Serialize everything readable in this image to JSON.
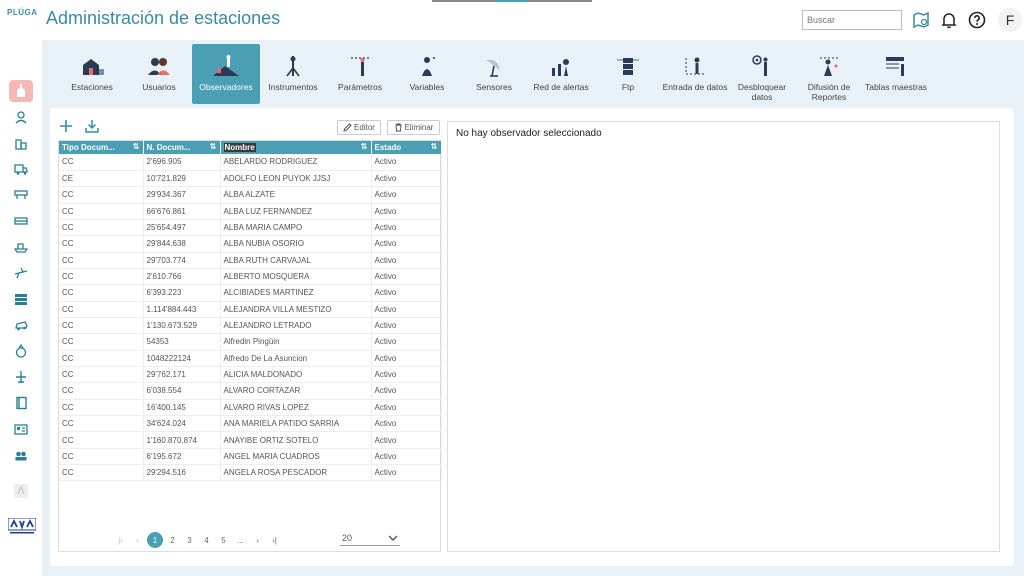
{
  "app": {
    "logo": "PLÜGA",
    "title": "Administración de estaciones"
  },
  "header": {
    "search_placeholder": "Buscar",
    "user_initial": "F"
  },
  "nav": {
    "items": [
      {
        "label": "Estaciones"
      },
      {
        "label": "Usuarios"
      },
      {
        "label": "Observadores",
        "active": true
      },
      {
        "label": "Instrumentos"
      },
      {
        "label": "Parámetros"
      },
      {
        "label": "Variables"
      },
      {
        "label": "Sensores"
      },
      {
        "label": "Red de alertas"
      },
      {
        "label": "Ftp"
      },
      {
        "label": "Entrada de datos"
      },
      {
        "label": "Desbloquear datos"
      },
      {
        "label": "Difusión de Reportes"
      },
      {
        "label": "Tablas maestras"
      }
    ]
  },
  "toolbar": {
    "edit_label": "Editor",
    "delete_label": "Eliminar"
  },
  "table": {
    "columns": [
      "Tipo Docum...",
      "N. Docum...",
      "Nombre",
      "Estado"
    ],
    "rows": [
      [
        "CC",
        "2'696.905",
        "ABELARDO RODRIGUEZ",
        "Activo"
      ],
      [
        "CE",
        "10'721.829",
        "ADOLFO LEON PUYOK JJSJ",
        "Activo"
      ],
      [
        "CC",
        "29'934.367",
        "ALBA ALZATE",
        "Activo"
      ],
      [
        "CC",
        "66'676.861",
        "ALBA LUZ FERNANDEZ",
        "Activo"
      ],
      [
        "CC",
        "25'654.497",
        "ALBA MARIA CAMPO",
        "Activo"
      ],
      [
        "CC",
        "29'844.638",
        "ALBA NUBIA OSORIO",
        "Activo"
      ],
      [
        "CC",
        "29'703.774",
        "ALBA RUTH CARVAJAL",
        "Activo"
      ],
      [
        "CC",
        "2'610.766",
        "ALBERTO MOSQUERA",
        "Activo"
      ],
      [
        "CC",
        "6'393.223",
        "ALCIBIADES MARTINEZ",
        "Activo"
      ],
      [
        "CC",
        "1.114'884.443",
        "ALEJANDRA VILLA MESTIZO",
        "Activo"
      ],
      [
        "CC",
        "1'130.673.529",
        "ALEJANDRO LETRADO",
        "Activo"
      ],
      [
        "CC",
        "54353",
        "Alfredin Pingüin",
        "Activo"
      ],
      [
        "CC",
        "1048222124",
        "Alfredo De La Asuncion",
        "Activo"
      ],
      [
        "CC",
        "29'762.171",
        "ALICIA MALDONADO",
        "Activo"
      ],
      [
        "CC",
        "6'038.554",
        "ALVARO CORTAZAR",
        "Activo"
      ],
      [
        "CC",
        "16'400.145",
        "ALVARO RIVAS LOPEZ",
        "Activo"
      ],
      [
        "CC",
        "34'624.024",
        "ANA MARIELA PATIDO SARRIA",
        "Activo"
      ],
      [
        "CC",
        "1'160.870.874",
        "ANAYIBE ORTIZ SOTELO",
        "Activo"
      ],
      [
        "CC",
        "6'195.672",
        "ANGEL MARIA CUADROS",
        "Activo"
      ],
      [
        "CC",
        "29'294.516",
        "ANGELA ROSA PESCADOR",
        "Activo"
      ]
    ]
  },
  "pager": {
    "first": "|‹",
    "prev": "‹",
    "pages": [
      "1",
      "2",
      "3",
      "4",
      "5",
      "..."
    ],
    "next": "›",
    "last": "›|",
    "page_size": "20"
  },
  "detail": {
    "empty_message": "No hay observador seleccionado"
  },
  "colors": {
    "accent": "#4a9fb5",
    "title": "#3b8aa0",
    "content_bg": "#e8f1f8",
    "sidebar_active": "#f5b8b8"
  }
}
